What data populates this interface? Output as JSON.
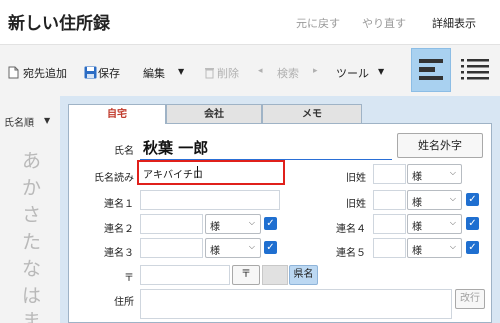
{
  "app": {
    "title": "新しい住所録"
  },
  "header": {
    "undo_label": "元に戻す",
    "redo_label": "やり直す",
    "detail_label": "詳細表示"
  },
  "toolbar": {
    "add_label": "宛先追加",
    "save_label": "保存",
    "edit_label": "編集",
    "delete_label": "削除",
    "search_label": "検索",
    "tools_label": "ツール"
  },
  "sidebar": {
    "sort_label": "氏名順",
    "kana": [
      "あ",
      "か",
      "さ",
      "た",
      "な",
      "は",
      "ま"
    ]
  },
  "tabs": {
    "home": "自宅",
    "work": "会社",
    "memo": "メモ"
  },
  "form": {
    "name_label": "氏名",
    "name_value": "秋葉 一郎",
    "gaiji_button": "姓名外字",
    "reading_label": "氏名読み",
    "reading_value": "アキバイチロ",
    "old_surname_label": "旧姓",
    "joint1_label": "連名１",
    "joint2_label": "連名２",
    "joint3_label": "連名３",
    "joint4_label": "連名４",
    "joint5_label": "連名５",
    "honorific": "様",
    "postal_label": "〒",
    "postal_button": "〒",
    "prefecture_button": "県名",
    "address_label": "住所",
    "newline_button": "改行"
  },
  "colors": {
    "accent": "#1f6fd0",
    "highlight": "#e0201b",
    "tab_active_text": "#c0392b",
    "panel_bg": "#d8e6f3"
  }
}
